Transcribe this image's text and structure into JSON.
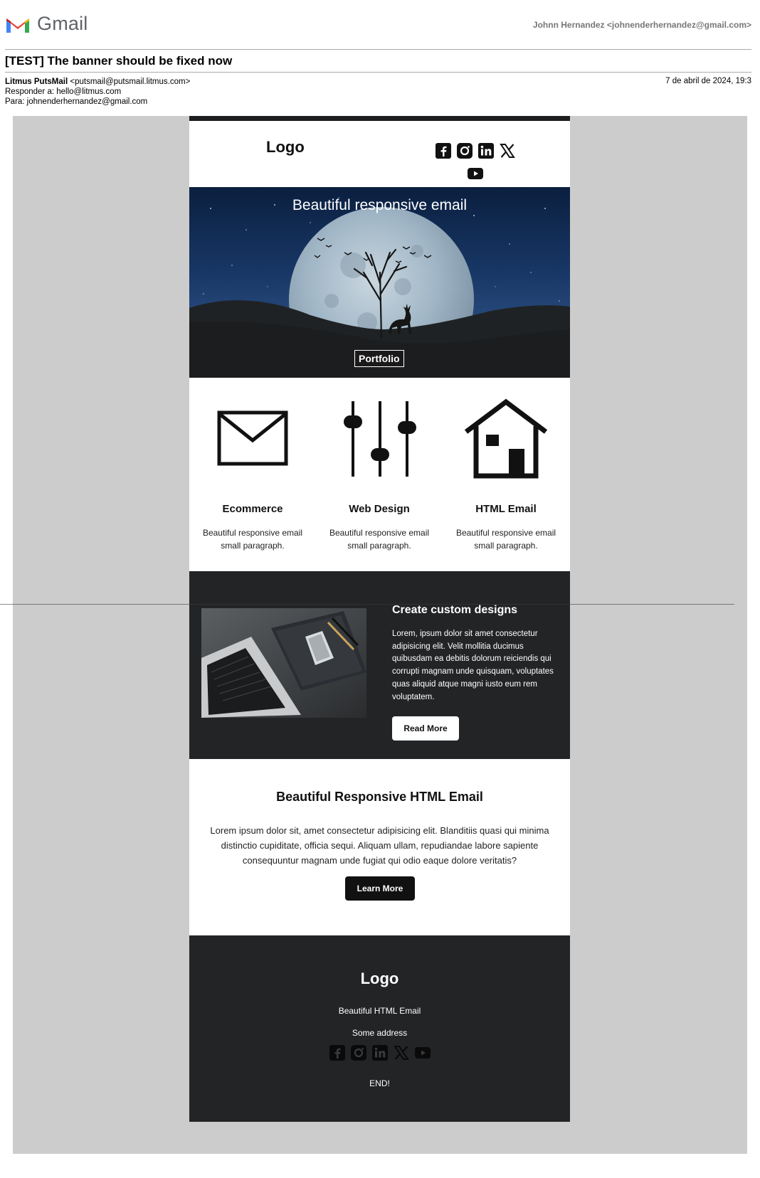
{
  "gmail": {
    "app_name": "Gmail",
    "account": "Johnn Hernandez <johnenderhernandez@gmail.com>",
    "subject": "[TEST] The banner should be fixed now",
    "sender_name": "Litmus PutsMail",
    "sender_email": "<putsmail@putsmail.litmus.com>",
    "reply_to": "Responder a: hello@litmus.com",
    "to": "Para: johnenderhernandez@gmail.com",
    "date": "7 de abril de 2024, 19:3"
  },
  "email": {
    "header": {
      "logo": "Logo",
      "social_icons": [
        "facebook-icon",
        "instagram-icon",
        "linkedin-icon",
        "x-icon",
        "youtube-icon"
      ]
    },
    "banner": {
      "title": "Beautiful responsive email",
      "button": "Portfolio"
    },
    "features": [
      {
        "icon": "envelope-icon",
        "title": "Ecommerce",
        "text": "Beautiful responsive email small paragraph."
      },
      {
        "icon": "sliders-icon",
        "title": "Web Design",
        "text": "Beautiful responsive email small paragraph."
      },
      {
        "icon": "house-icon",
        "title": "HTML Email",
        "text": "Beautiful responsive email small paragraph."
      }
    ],
    "custom": {
      "title": "Create custom designs",
      "text": "Lorem, ipsum dolor sit amet consectetur adipisicing elit. Velit mollitia ducimus quibusdam ea debitis dolorum reiciendis qui corrupti magnam unde quisquam, voluptates quas aliquid atque magni iusto eum rem voluptatem.",
      "button": "Read More"
    },
    "info": {
      "title": "Beautiful Responsive HTML Email",
      "text": "Lorem ipsum dolor sit, amet consectetur adipisicing elit. Blanditiis quasi qui minima distinctio cupiditate, officia sequi. Aliquam ullam, repudiandae labore sapiente consequuntur magnam unde fugiat qui odio eaque dolore veritatis?",
      "button": "Learn More"
    },
    "footer": {
      "logo": "Logo",
      "line1": "Beautiful HTML Email",
      "line2": "Some address",
      "end": "END!"
    }
  },
  "colors": {
    "dark": "#222426",
    "canvas": "#cccccc",
    "white": "#ffffff"
  }
}
